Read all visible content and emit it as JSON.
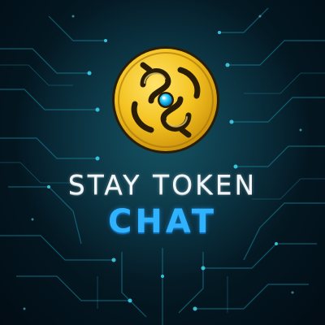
{
  "brand": {
    "title": "STAY TOKEN",
    "subtitle": "CHAT",
    "logo_icon": "stay-token-coin-icon"
  },
  "colors": {
    "background": "#041a24",
    "circuit": "#1c8fa8",
    "title": "#f2f6f8",
    "subtitle": "#2fb3ff",
    "coin_gold": "#f3c21f",
    "coin_gem": "#19c7ff"
  }
}
